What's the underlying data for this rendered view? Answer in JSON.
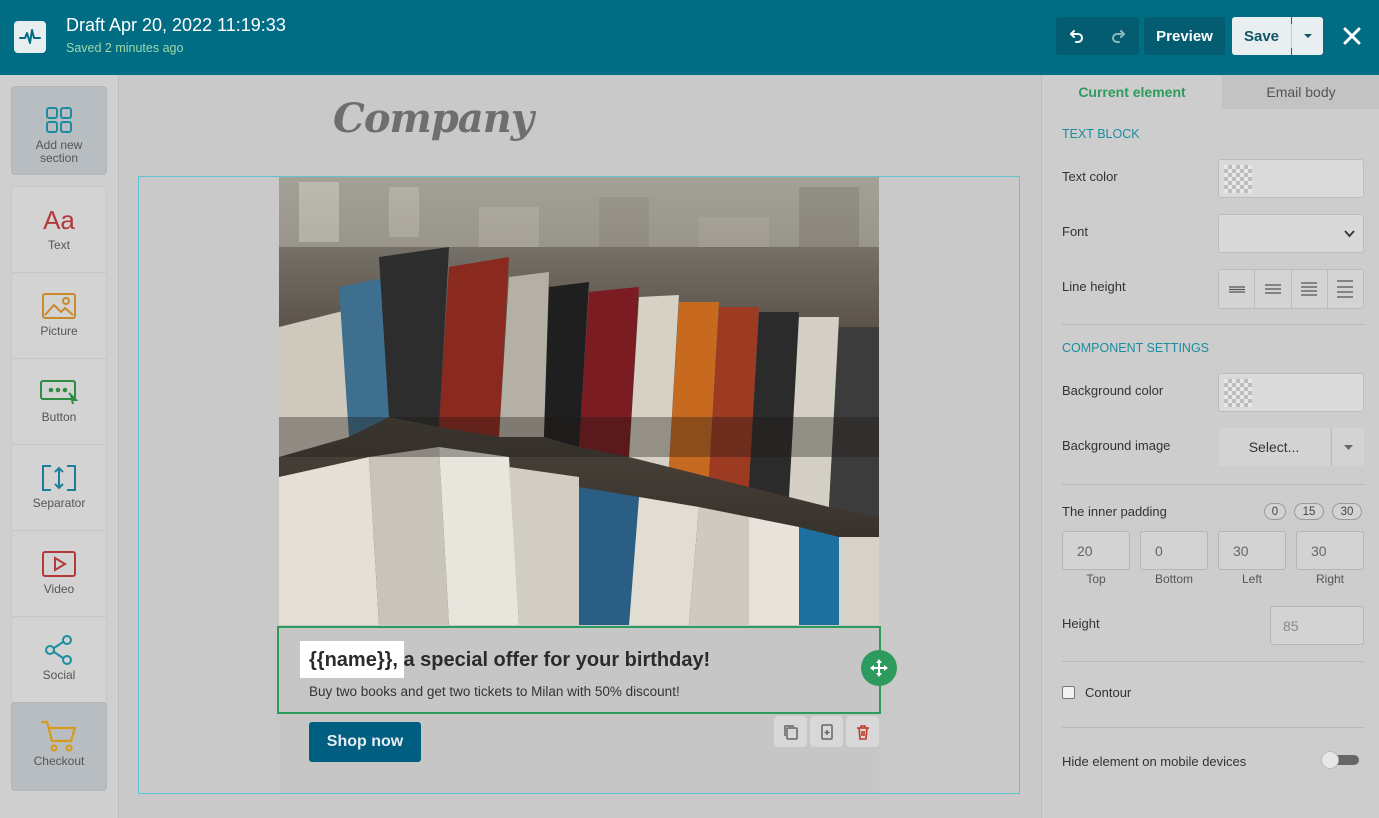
{
  "header": {
    "title": "Draft Apr 20, 2022 11:19:33",
    "subtitle": "Saved 2 minutes ago",
    "preview_label": "Preview",
    "save_label": "Save"
  },
  "sidebar": {
    "items": [
      {
        "label": "Add new section",
        "icon": "grid-icon"
      },
      {
        "label": "Text",
        "icon": "text-aa-icon"
      },
      {
        "label": "Picture",
        "icon": "picture-icon"
      },
      {
        "label": "Button",
        "icon": "button-icon"
      },
      {
        "label": "Separator",
        "icon": "separator-icon"
      },
      {
        "label": "Video",
        "icon": "video-icon"
      },
      {
        "label": "Social",
        "icon": "share-icon"
      },
      {
        "label": "Checkout",
        "icon": "cart-icon"
      }
    ]
  },
  "canvas": {
    "brand": "Company",
    "headline": "{{name}}, a special offer for your birthday!",
    "subline": "Buy two books and get two tickets to Milan with 50% discount!",
    "cta": "Shop now"
  },
  "panel": {
    "tabs": [
      "Current element",
      "Email body"
    ],
    "text_block": {
      "heading": "TEXT BLOCK",
      "text_color_label": "Text color",
      "font_label": "Font",
      "line_height_label": "Line height"
    },
    "component_settings": {
      "heading": "COMPONENT SETTINGS",
      "bg_color_label": "Background color",
      "bg_image_label": "Background image",
      "bg_image_select": "Select...",
      "inner_padding_label": "The inner padding",
      "presets": [
        "0",
        "15",
        "30"
      ],
      "padding": [
        {
          "label": "Top",
          "value": "20"
        },
        {
          "label": "Bottom",
          "value": "0"
        },
        {
          "label": "Left",
          "value": "30"
        },
        {
          "label": "Right",
          "value": "30"
        }
      ],
      "height_label": "Height",
      "height_placeholder": "85",
      "contour_label": "Contour",
      "hide_mobile_label": "Hide element on mobile devices"
    }
  },
  "colors": {
    "topbar": "#006d84",
    "accent_green": "#2e9b5e",
    "section_heading": "#1c8da0",
    "cta": "#005e80"
  }
}
